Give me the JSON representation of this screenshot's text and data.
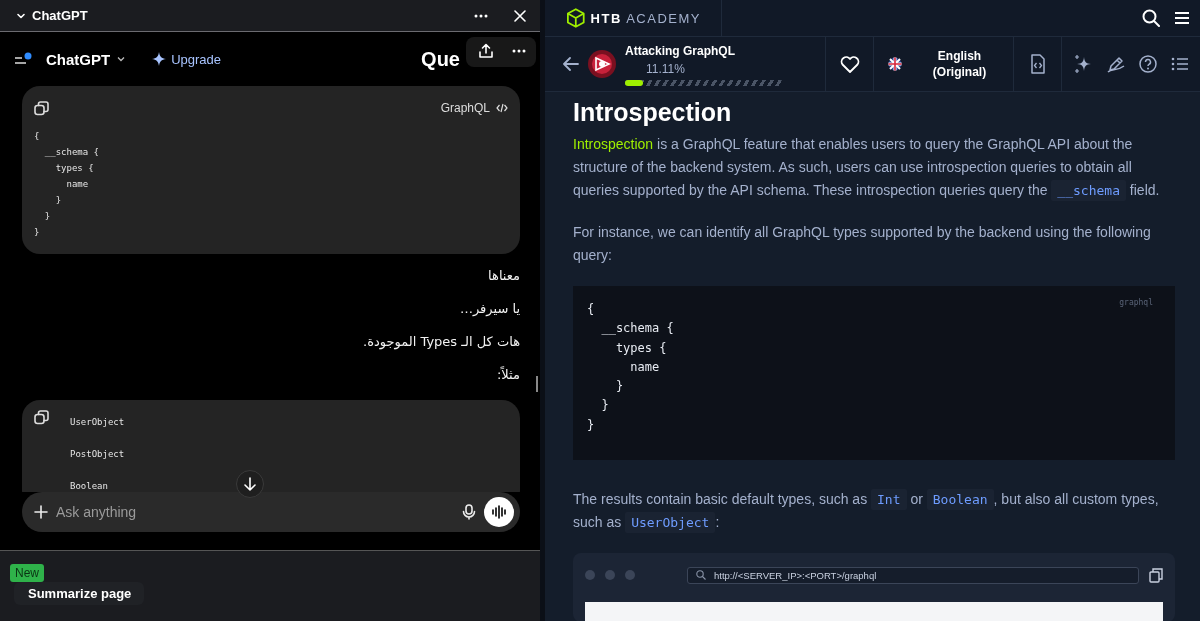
{
  "chatgpt_panel": {
    "title": "ChatGPT",
    "header": {
      "model": "ChatGPT",
      "upgrade": "Upgrade",
      "conversation_title": "Que"
    },
    "messages": [
      {
        "kind": "code",
        "language": "GraphQL",
        "code": "{\n  __schema {\n    types {\n      name\n    }\n  }\n}"
      },
      {
        "kind": "text",
        "text": "معناها"
      },
      {
        "kind": "text",
        "text": "يا سيرفر…"
      },
      {
        "kind": "text",
        "text": "هات كل الـ Types الموجودة."
      },
      {
        "kind": "text",
        "text": "مثلاً:"
      },
      {
        "kind": "code",
        "code": "UserObject\n\nPostObject\n\nBoolean"
      }
    ],
    "composer": {
      "placeholder": "Ask anything"
    },
    "footer": {
      "button": "Summarize page",
      "badge": "New"
    }
  },
  "htb_panel": {
    "brand": {
      "strong": "HTB",
      "light": "ACADEMY"
    },
    "course": {
      "title": "Attacking GraphQL",
      "progress": "11.11%",
      "level": 0.1111
    },
    "language": "English (Original)",
    "article": {
      "heading": "Introspection",
      "blocks": [
        {
          "kind": "paragraph",
          "parts": [
            {
              "kind": "link",
              "text": "Introspection"
            },
            {
              "kind": "text",
              "text": " is a GraphQL feature that enables users to query the GraphQL API about the structure of the backend system. As such, users can use introspection queries to obtain all queries supported by the API schema. These introspection queries query the "
            },
            {
              "kind": "code",
              "text": "__schema"
            },
            {
              "kind": "text",
              "text": " field."
            }
          ]
        },
        {
          "kind": "paragraph",
          "parts": [
            {
              "kind": "text",
              "text": "For instance, we can identify all GraphQL types supported by the backend using the following query:"
            }
          ]
        },
        {
          "kind": "code",
          "language": "graphql",
          "code": "{\n  __schema {\n    types {\n      name\n    }\n  }\n}"
        },
        {
          "kind": "paragraph",
          "parts": [
            {
              "kind": "text",
              "text": "The results contain basic default types, such as "
            },
            {
              "kind": "code",
              "text": "Int"
            },
            {
              "kind": "text",
              "text": " or "
            },
            {
              "kind": "code",
              "text": "Boolean"
            },
            {
              "kind": "text",
              "text": ", but also all custom types, such as "
            },
            {
              "kind": "code",
              "text": "UserObject"
            },
            {
              "kind": "text",
              "text": ":"
            }
          ]
        },
        {
          "kind": "browser",
          "url": "http://<SERVER_IP>:<PORT>/graphql"
        }
      ]
    }
  }
}
